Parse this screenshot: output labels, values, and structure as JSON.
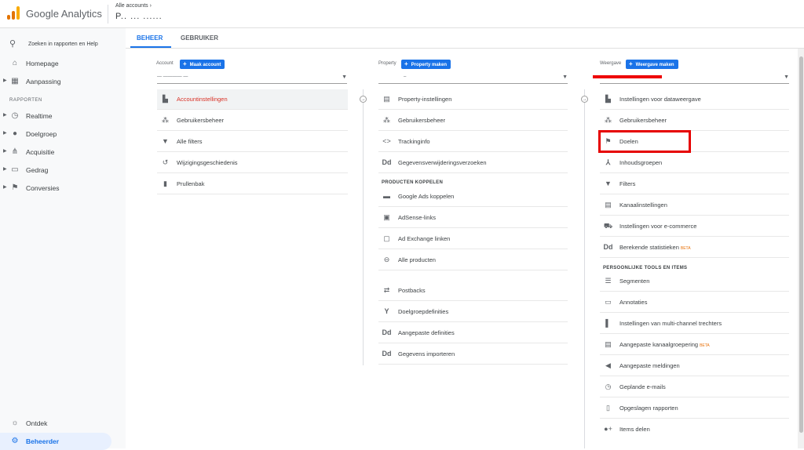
{
  "app": {
    "title": "Google Analytics",
    "breadcrumb": "Alle accounts",
    "property_name": "P.. ... ......",
    "logo_colors": [
      "#f9ab00",
      "#e37400",
      "#e37400"
    ]
  },
  "sidebar": {
    "search_label": "Zoeken in rapporten en Help",
    "section_label": "RAPPORTEN",
    "items": [
      {
        "label": "Homepage",
        "icon": "home-icon",
        "glyph": "⌂"
      },
      {
        "label": "Aanpassing",
        "icon": "grid-icon",
        "glyph": "▦"
      },
      {
        "label": "Realtime",
        "icon": "clock-icon",
        "glyph": "◷"
      },
      {
        "label": "Doelgroep",
        "icon": "person-icon",
        "glyph": "●"
      },
      {
        "label": "Acquisitie",
        "icon": "acquisition-icon",
        "glyph": "⋔"
      },
      {
        "label": "Gedrag",
        "icon": "window-icon",
        "glyph": "▭"
      },
      {
        "label": "Conversies",
        "icon": "flag-icon",
        "glyph": "⚑"
      }
    ],
    "bottom_items": [
      {
        "label": "Ontdek",
        "icon": "lightbulb-icon",
        "glyph": "☼"
      },
      {
        "label": "Beheerder",
        "icon": "gear-icon",
        "glyph": "⚙"
      }
    ]
  },
  "tabs": [
    {
      "label": "BEHEER",
      "active": true
    },
    {
      "label": "GEBRUIKER",
      "active": false
    }
  ],
  "columns": {
    "account": {
      "label": "Account",
      "button": "Maak account",
      "items": [
        {
          "label": "Accountinstellingen",
          "icon": "building-icon",
          "glyph": "▙",
          "selected": true
        },
        {
          "label": "Gebruikersbeheer",
          "icon": "users-icon",
          "glyph": "⁂"
        },
        {
          "label": "Alle filters",
          "icon": "filter-icon",
          "glyph": "▼"
        },
        {
          "label": "Wijzigingsgeschiedenis",
          "icon": "history-icon",
          "glyph": "↺"
        },
        {
          "label": "Prullenbak",
          "icon": "trash-icon",
          "glyph": "▮"
        }
      ]
    },
    "property": {
      "label": "Property",
      "button": "Property maken",
      "section_title": "PRODUCTEN KOPPELEN",
      "items": [
        {
          "label": "Property-instellingen",
          "icon": "settings-window-icon",
          "glyph": "▤"
        },
        {
          "label": "Gebruikersbeheer",
          "icon": "users-icon",
          "glyph": "⁂"
        },
        {
          "label": "Trackinginfo",
          "icon": "code-icon",
          "glyph": "<>"
        },
        {
          "label": "Gegevensverwijderingsverzoeken",
          "icon": "dd-icon",
          "glyph": "Dd"
        }
      ],
      "linked": [
        {
          "label": "Google Ads koppelen",
          "icon": "ads-icon",
          "glyph": "▬"
        },
        {
          "label": "AdSense-links",
          "icon": "adsense-icon",
          "glyph": "▣"
        },
        {
          "label": "Ad Exchange linken",
          "icon": "adexchange-icon",
          "glyph": "▢"
        },
        {
          "label": "Alle producten",
          "icon": "link-icon",
          "glyph": "⊖"
        }
      ],
      "more": [
        {
          "label": "Postbacks",
          "icon": "postback-icon",
          "glyph": "⇄"
        },
        {
          "label": "Doelgroepdefinities",
          "icon": "audience-icon",
          "glyph": "Y"
        },
        {
          "label": "Aangepaste definities",
          "icon": "dd-icon",
          "glyph": "Dd"
        },
        {
          "label": "Gegevens importeren",
          "icon": "dd-icon",
          "glyph": "Dd"
        }
      ]
    },
    "view": {
      "label": "Weergave",
      "button": "Weergave maken",
      "section_title": "PERSOONLIJKE TOOLS EN ITEMS",
      "beta": "BETA",
      "items": [
        {
          "label": "Instellingen voor dataweergave",
          "icon": "document-icon",
          "glyph": "▙"
        },
        {
          "label": "Gebruikersbeheer",
          "icon": "users-icon",
          "glyph": "⁂"
        },
        {
          "label": "Doelen",
          "icon": "flag-icon",
          "glyph": "⚑"
        },
        {
          "label": "Inhoudsgroepen",
          "icon": "content-group-icon",
          "glyph": "⅄"
        },
        {
          "label": "Filters",
          "icon": "filter-icon",
          "glyph": "▼"
        },
        {
          "label": "Kanaalinstellingen",
          "icon": "channel-icon",
          "glyph": "▤"
        },
        {
          "label": "Instellingen voor e-commerce",
          "icon": "cart-icon",
          "glyph": "🛒"
        },
        {
          "label": "Berekende statistieken",
          "icon": "dd-icon",
          "glyph": "Dd",
          "beta": true
        }
      ],
      "personal": [
        {
          "label": "Segmenten",
          "icon": "segments-icon",
          "glyph": "☰"
        },
        {
          "label": "Annotaties",
          "icon": "comment-icon",
          "glyph": "▭"
        },
        {
          "label": "Instellingen van multi-channel trechters",
          "icon": "bar-chart-icon",
          "glyph": "▌"
        },
        {
          "label": "Aangepaste kanaalgroepering",
          "icon": "channel-icon",
          "glyph": "▤",
          "beta": true
        },
        {
          "label": "Aangepaste meldingen",
          "icon": "megaphone-icon",
          "glyph": "◀"
        },
        {
          "label": "Geplande e-mails",
          "icon": "schedule-icon",
          "glyph": "◷"
        },
        {
          "label": "Opgeslagen rapporten",
          "icon": "saved-report-icon",
          "glyph": "▯"
        },
        {
          "label": "Items delen",
          "icon": "share-person-icon",
          "glyph": "●+"
        }
      ]
    }
  }
}
